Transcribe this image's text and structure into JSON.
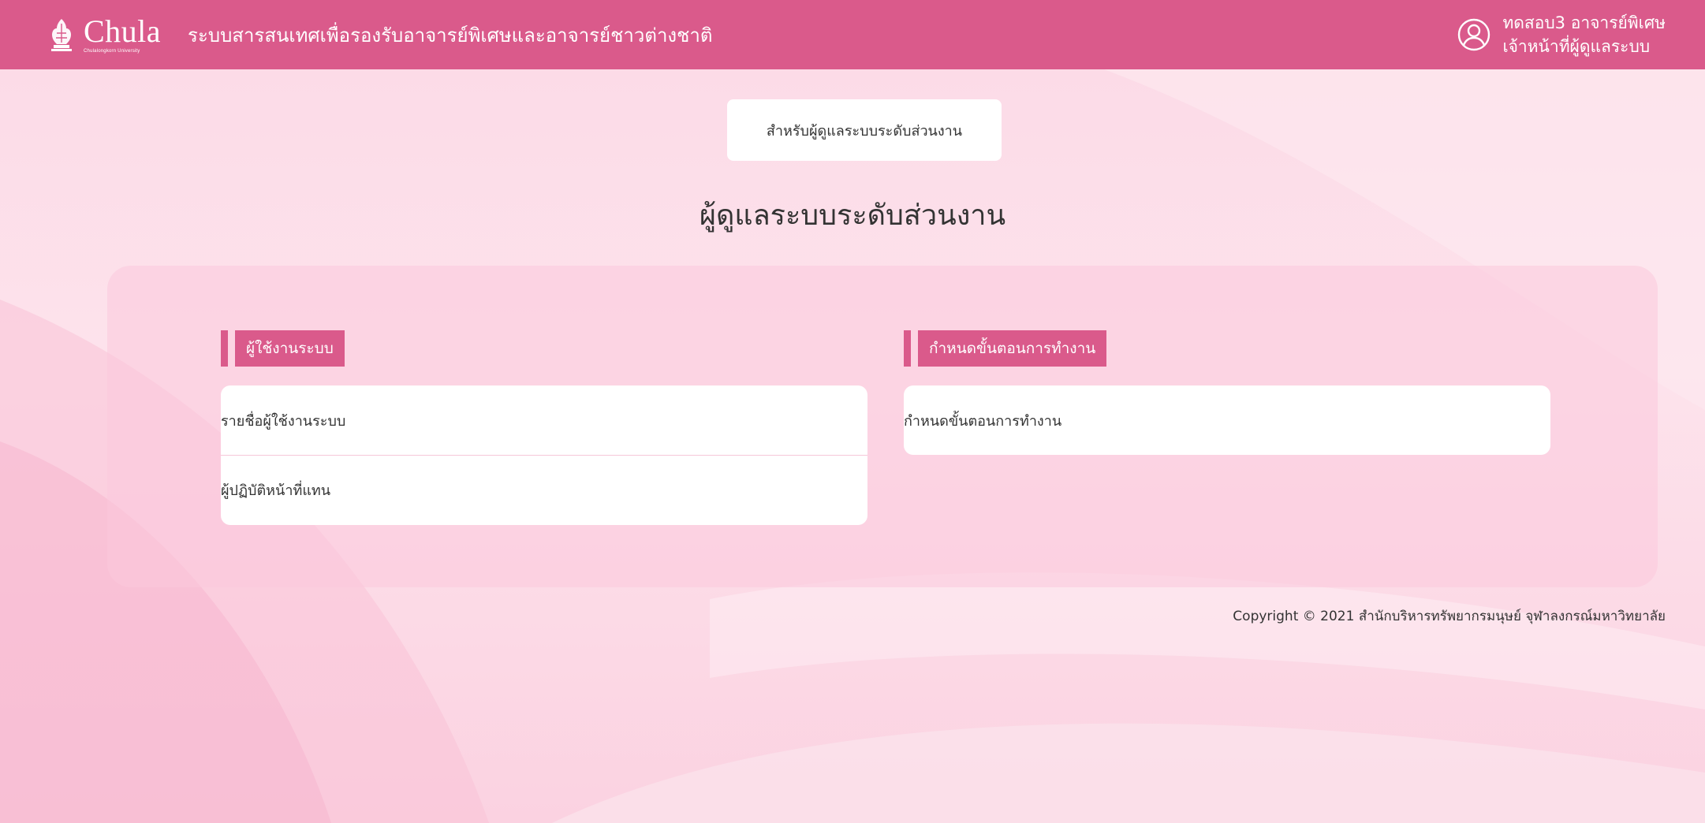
{
  "header": {
    "logo_word": "Chula",
    "logo_sub": "Chulalongkorn University",
    "system_title": "ระบบสารสนเทศเพื่อรองรับอาจารย์พิเศษและอาจารย์ชาวต่างชาติ",
    "user_name": "ทดสอบ3 อาจารย์พิเศษ",
    "user_role": "เจ้าหน้าที่ผู้ดูแลระบบ"
  },
  "main": {
    "tab_label": "สำหรับผู้ดูแลระบบระดับส่วนงาน",
    "page_title": "ผู้ดูแลระบบระดับส่วนงาน",
    "sections": [
      {
        "title": "ผู้ใช้งานระบบ",
        "items": [
          "รายชื่อผู้ใช้งานระบบ",
          "ผู้ปฏิบัติหน้าที่แทน"
        ]
      },
      {
        "title": "กำหนดขั้นตอนการทำงาน",
        "items": [
          "กำหนดขั้นตอนการทำงาน"
        ]
      }
    ]
  },
  "footer": {
    "copyright": "Copyright © 2021 สำนักบริหารทรัพยากรมนุษย์ จุฬาลงกรณ์มหาวิทยาลัย"
  },
  "colors": {
    "brand_pink": "#da5a8b",
    "background": "#fcdbe7",
    "card": "#ffffff"
  },
  "icons": {
    "logo": "chula-emblem-icon",
    "user": "user-circle-icon"
  }
}
